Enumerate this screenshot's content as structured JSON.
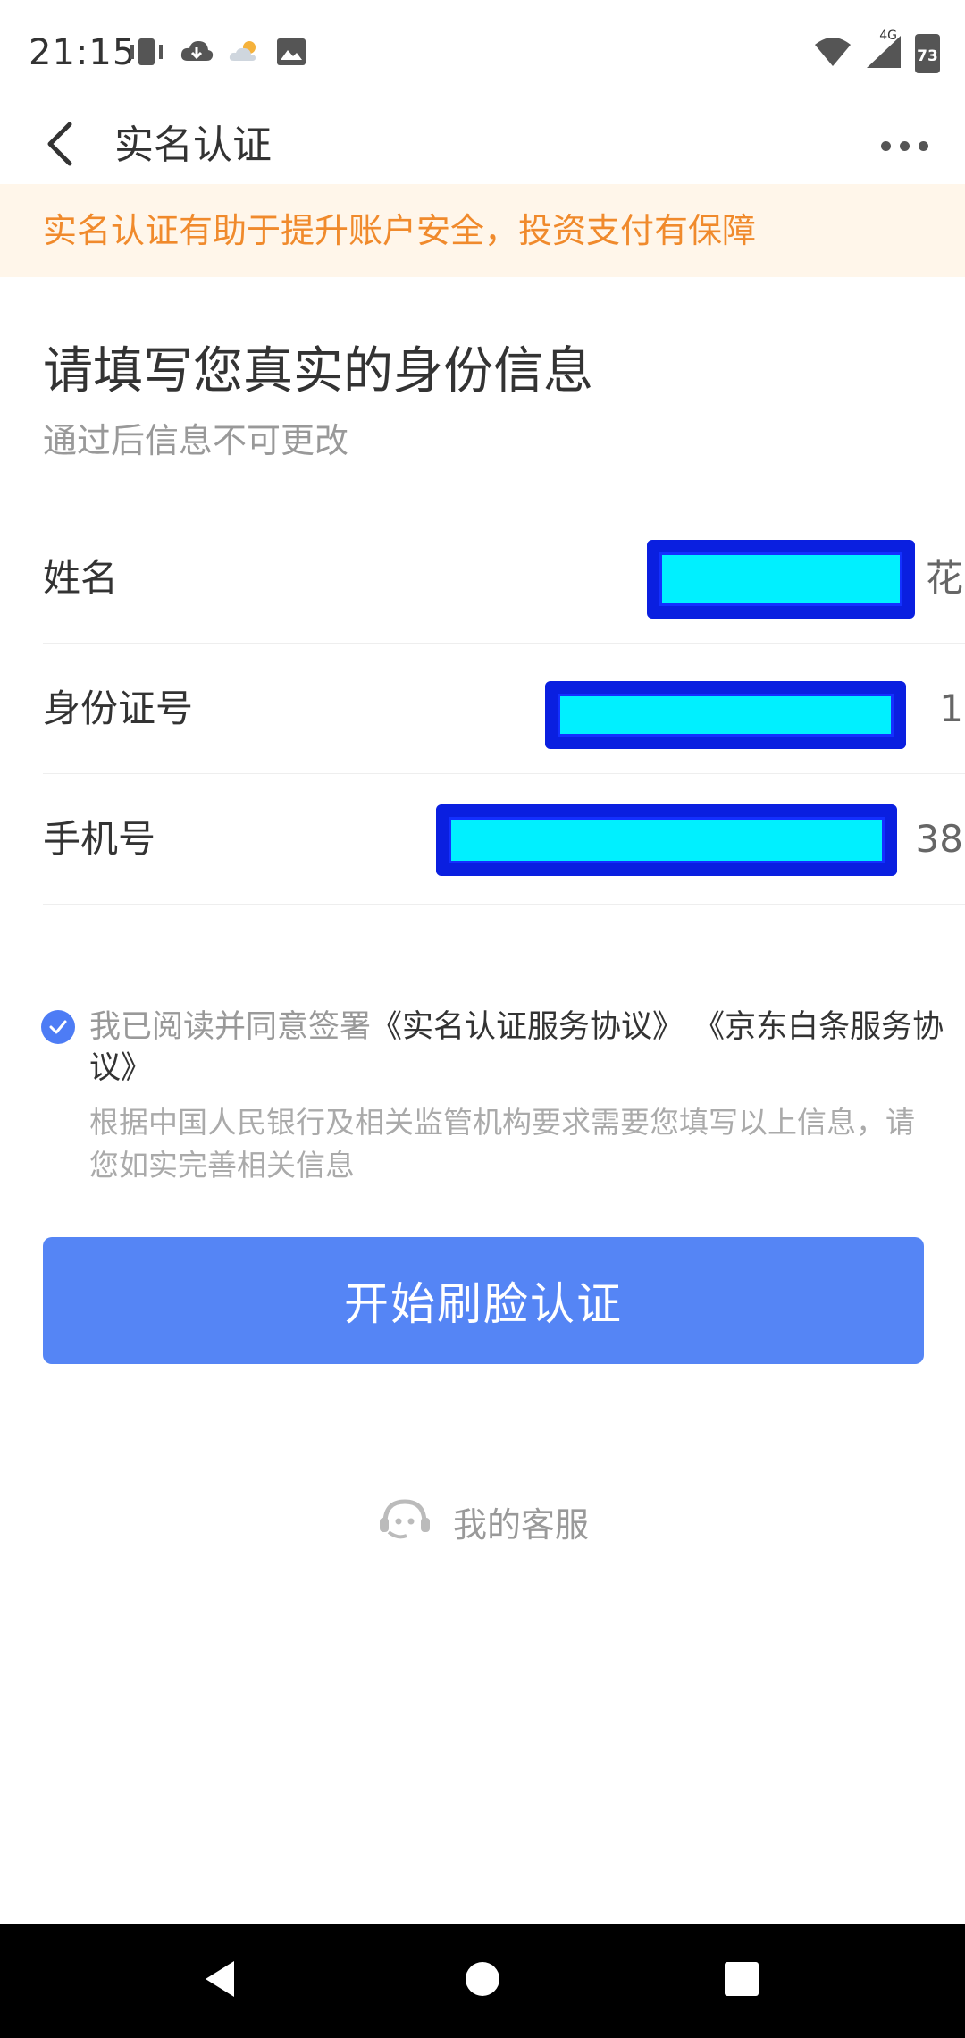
{
  "status_bar": {
    "time": "21:15",
    "network": "4G",
    "battery": "73",
    "icons": [
      "vibrate-icon",
      "cloud-download-icon",
      "weather-icon",
      "image-icon",
      "wifi-icon",
      "signal-icon",
      "battery-icon"
    ]
  },
  "nav": {
    "title": "实名认证",
    "back_icon": "chevron-left-icon",
    "more_icon": "more-icon"
  },
  "notice": {
    "text": "实名认证有助于提升账户安全，投资支付有保障",
    "color": "#f08a2c"
  },
  "form": {
    "title": "请填写您真实的身份信息",
    "subtitle": "通过后信息不可更改",
    "fields": [
      {
        "label": "姓名",
        "value_tail": "花"
      },
      {
        "label": "身份证号",
        "value_tail": "1"
      },
      {
        "label": "手机号",
        "value_tail": "38"
      }
    ]
  },
  "agreement": {
    "checked": true,
    "prefix": "我已阅读并同意签署",
    "link1": "《实名认证服务协议》",
    "link2": "《京东白条服务协议》",
    "hint": "根据中国人民银行及相关监管机构要求需要您填写以上信息，请您如实完善相关信息"
  },
  "primary_button": {
    "label": "开始刷脸认证",
    "color": "#5585f5"
  },
  "service": {
    "label": "我的客服",
    "icon": "customer-service-icon"
  },
  "system_nav": {
    "icons": [
      "nav-back-icon",
      "nav-home-icon",
      "nav-recents-icon"
    ]
  }
}
